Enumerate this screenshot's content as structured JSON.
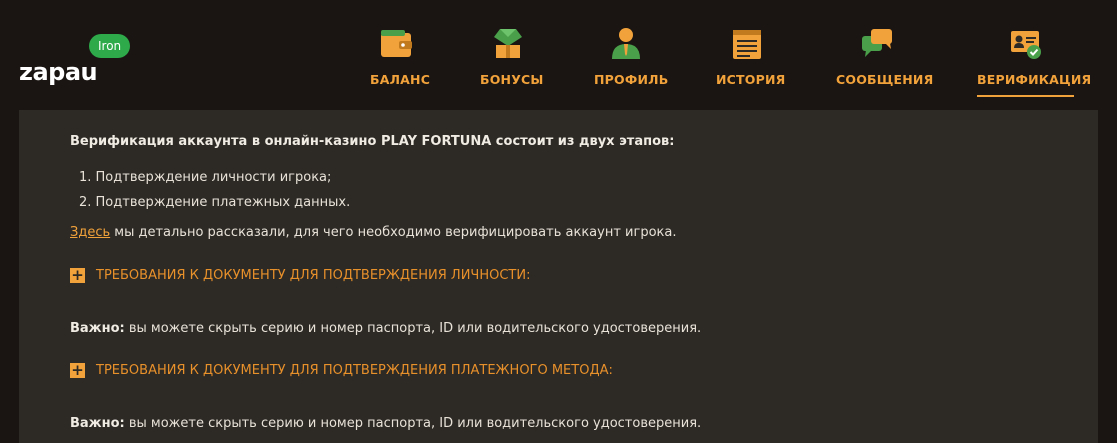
{
  "header": {
    "logo": "zapau",
    "level_badge": "Iron"
  },
  "nav": {
    "items": [
      {
        "label": "БАЛАНС",
        "icon": "wallet-icon"
      },
      {
        "label": "БОНУСЫ",
        "icon": "gift-icon"
      },
      {
        "label": "ПРОФИЛЬ",
        "icon": "user-icon"
      },
      {
        "label": "ИСТОРИЯ",
        "icon": "notepad-icon"
      },
      {
        "label": "СООБЩЕНИЯ",
        "icon": "chat-icon"
      },
      {
        "label": "ВЕРИФИКАЦИЯ",
        "icon": "id-card-check-icon"
      }
    ],
    "active": "ВЕРИФИКАЦИЯ"
  },
  "content": {
    "intro": "Верификация аккаунта в онлайн-казино PLAY FORTUNA состоит из двух этапов:",
    "steps": [
      "1. Подтверждение личности игрока;",
      "2. Подтверждение платежных данных."
    ],
    "here_link": "Здесь",
    "here_text": " мы детально рассказали, для чего необходимо верифицировать аккаунт игрока.",
    "accordion_1": "ТРЕБОВАНИЯ К ДОКУМЕНТУ ДЛЯ ПОДТВЕРЖДЕНИЯ ЛИЧНОСТИ:",
    "accordion_2": "ТРЕБОВАНИЯ К ДОКУМЕНТУ ДЛЯ ПОДТВЕРЖДЕНИЯ ПЛАТЕЖНОГО МЕТОДА:",
    "important_label": "Важно:",
    "important_text": " вы можете скрыть серию и номер паспорта, ID или водительского удостоверения."
  },
  "colors": {
    "accent": "#f2a23a",
    "badge": "#2eaa4a",
    "panel": "#2d2a26",
    "background": "#1a1512"
  }
}
